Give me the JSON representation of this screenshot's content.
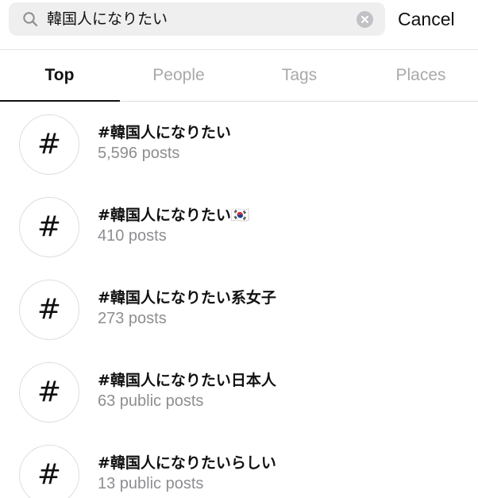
{
  "search": {
    "value": "韓国人になりたい",
    "cancel_label": "Cancel"
  },
  "tabs": [
    {
      "label": "Top",
      "active": true
    },
    {
      "label": "People",
      "active": false
    },
    {
      "label": "Tags",
      "active": false
    },
    {
      "label": "Places",
      "active": false
    }
  ],
  "results": [
    {
      "icon": "#",
      "name": "#韓国人になりたい",
      "count": "5,596 posts"
    },
    {
      "icon": "#",
      "name": "#韓国人になりたい🇰🇷",
      "count": "410 posts"
    },
    {
      "icon": "#",
      "name": "#韓国人になりたい系女子",
      "count": "273 posts"
    },
    {
      "icon": "#",
      "name": "#韓国人になりたい日本人",
      "count": "63 public posts"
    },
    {
      "icon": "#",
      "name": "#韓国人になりたいらしい",
      "count": "13 public posts"
    }
  ],
  "colors": {
    "search_bg": "#efeff0",
    "inactive_tab": "#a9a9ab",
    "secondary_text": "#8e8e92"
  }
}
